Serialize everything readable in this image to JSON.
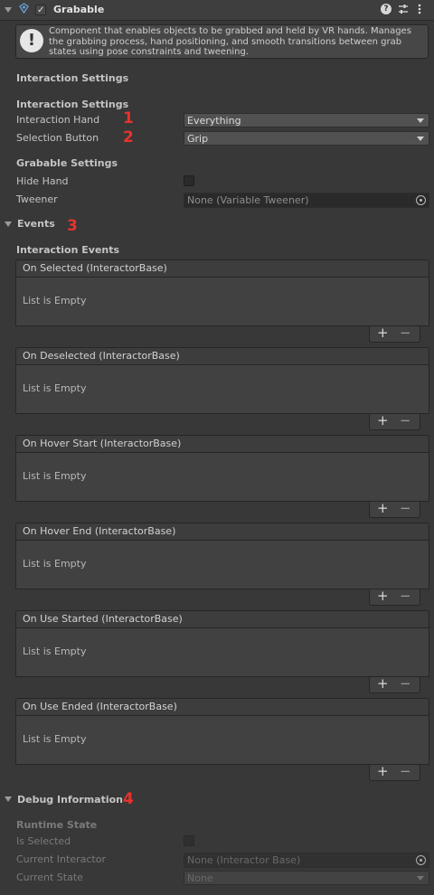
{
  "component": {
    "title": "Grabable",
    "enabled": true,
    "help_text": "Component that enables objects to be grabbed and held by VR hands. Manages the grabbing process, hand positioning, and smooth transitions between grab states using pose constraints and tweening."
  },
  "header_icons": [
    "script-icon",
    "help-icon",
    "preset-icon",
    "kebab-menu-icon"
  ],
  "sections": {
    "interaction_settings_top": "Interaction Settings",
    "interaction_settings": "Interaction Settings",
    "grabable_settings": "Grabable Settings",
    "events": "Events",
    "interaction_events": "Interaction Events",
    "debug_information": "Debug Information",
    "runtime_state": "Runtime State"
  },
  "fields": {
    "interaction_hand": {
      "label": "Interaction Hand",
      "value": "Everything"
    },
    "selection_button": {
      "label": "Selection Button",
      "value": "Grip"
    },
    "hide_hand": {
      "label": "Hide Hand",
      "checked": false
    },
    "tweener": {
      "label": "Tweener",
      "value": "None (Variable Tweener)"
    },
    "is_selected": {
      "label": "Is Selected",
      "checked": false
    },
    "current_interactor": {
      "label": "Current Interactor",
      "value": "None (Interactor Base)"
    },
    "current_state": {
      "label": "Current State",
      "value": "None"
    }
  },
  "annotations": [
    "1",
    "2",
    "3",
    "4"
  ],
  "events": [
    {
      "title": "On Selected (InteractorBase)",
      "body": "List is Empty"
    },
    {
      "title": "On Deselected (InteractorBase)",
      "body": "List is Empty"
    },
    {
      "title": "On Hover Start (InteractorBase)",
      "body": "List is Empty"
    },
    {
      "title": "On Hover End (InteractorBase)",
      "body": "List is Empty"
    },
    {
      "title": "On Use Started (InteractorBase)",
      "body": "List is Empty"
    },
    {
      "title": "On Use Ended (InteractorBase)",
      "body": "List is Empty"
    }
  ],
  "list_controls": {
    "add": "+",
    "remove": "−"
  },
  "colors": {
    "background": "#383838",
    "annotation": "#e8322d",
    "field": "#515151"
  }
}
